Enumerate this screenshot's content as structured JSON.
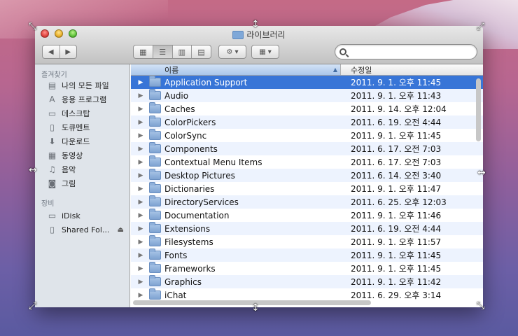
{
  "window": {
    "title": "라이브러리"
  },
  "toolbar": {
    "back_icon": "◀",
    "forward_icon": "▶",
    "view_icon_icon": "▦",
    "view_list_icon": "☰",
    "view_column_icon": "▥",
    "view_coverflow_icon": "▤",
    "action_icon": "⚙",
    "arrange_icon": "▦",
    "dropdown_icon": "▾",
    "search_placeholder": ""
  },
  "sidebar": {
    "favorites_header": "즐겨찾기",
    "favorites": [
      {
        "label": "나의 모든 파일",
        "icon": "▤"
      },
      {
        "label": "응용 프로그램",
        "icon": "A"
      },
      {
        "label": "데스크탑",
        "icon": "▭"
      },
      {
        "label": "도큐멘트",
        "icon": "▯"
      },
      {
        "label": "다운로드",
        "icon": "⬇"
      },
      {
        "label": "동영상",
        "icon": "▦"
      },
      {
        "label": "음악",
        "icon": "♫"
      },
      {
        "label": "그림",
        "icon": "◙"
      }
    ],
    "devices_header": "장비",
    "devices": [
      {
        "label": "iDisk",
        "icon": "▭"
      },
      {
        "label": "Shared Fol...",
        "icon": "▯",
        "eject": "⏏"
      }
    ]
  },
  "list": {
    "col_name": "이름",
    "col_date": "수정일",
    "sort_indicator": "▲",
    "rows": [
      {
        "name": "Application Support",
        "date": "2011. 9. 1. 오후 11:45",
        "selected": true
      },
      {
        "name": "Audio",
        "date": "2011. 9. 1. 오후 11:43"
      },
      {
        "name": "Caches",
        "date": "2011. 9. 14. 오후 12:04"
      },
      {
        "name": "ColorPickers",
        "date": "2011. 6. 19. 오전 4:44"
      },
      {
        "name": "ColorSync",
        "date": "2011. 9. 1. 오후 11:45"
      },
      {
        "name": "Components",
        "date": "2011. 6. 17. 오전 7:03"
      },
      {
        "name": "Contextual Menu Items",
        "date": "2011. 6. 17. 오전 7:03"
      },
      {
        "name": "Desktop Pictures",
        "date": "2011. 6. 14. 오전 3:40"
      },
      {
        "name": "Dictionaries",
        "date": "2011. 9. 1. 오후 11:47"
      },
      {
        "name": "DirectoryServices",
        "date": "2011. 6. 25. 오후 12:03"
      },
      {
        "name": "Documentation",
        "date": "2011. 9. 1. 오후 11:46"
      },
      {
        "name": "Extensions",
        "date": "2011. 6. 19. 오전 4:44"
      },
      {
        "name": "Filesystems",
        "date": "2011. 9. 1. 오후 11:57"
      },
      {
        "name": "Fonts",
        "date": "2011. 9. 1. 오후 11:45"
      },
      {
        "name": "Frameworks",
        "date": "2011. 9. 1. 오후 11:45"
      },
      {
        "name": "Graphics",
        "date": "2011. 9. 1. 오후 11:42"
      },
      {
        "name": "iChat",
        "date": "2011. 6. 29. 오후 3:14"
      }
    ]
  },
  "colors": {
    "selection": "#3875d7",
    "sidebar_bg": "#dfe4ea"
  }
}
